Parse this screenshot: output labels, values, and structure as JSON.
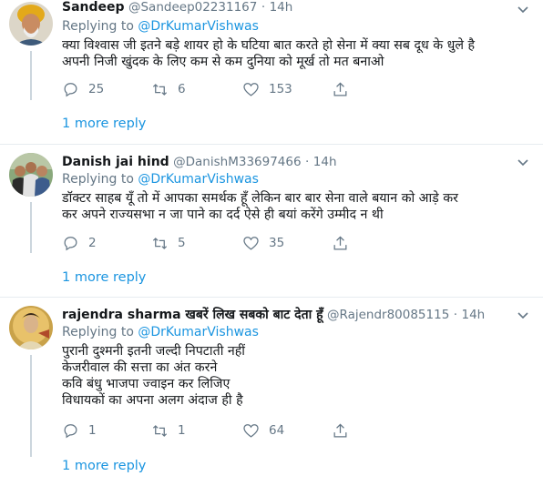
{
  "tweets": [
    {
      "name": "Sandeep",
      "handle": "@Sandeep02231167",
      "sep": "·",
      "time": "14h",
      "replying_prefix": "Replying to",
      "replying_to": "@DrKumarVishwas",
      "lines": [
        "क्या विश्वास जी इतने बड़े शायर हो के घटिया बात करते हो सेना में क्या सब दूध के धुले है",
        "अपनी निजी खुंदक के लिए कम से कम दुनिया को मूर्ख  तो मत बनाओ"
      ],
      "replies": "25",
      "retweets": "6",
      "likes": "153",
      "more": "1 more reply"
    },
    {
      "name": "Danish jai hind",
      "handle": "@DanishM33697466",
      "sep": "·",
      "time": "14h",
      "replying_prefix": "Replying to",
      "replying_to": "@DrKumarVishwas",
      "lines": [
        "डॉक्टर साहब यूँ तो में आपका समर्थक हूँ लेकिन बार बार सेना वाले बयान को आड़े कर",
        "कर अपने राज्यसभा न जा पाने का दर्द ऐसे ही बयां करेंगे उम्मीद न थी"
      ],
      "replies": "2",
      "retweets": "5",
      "likes": "35",
      "more": "1 more reply"
    },
    {
      "name": "rajendra sharma खबरें लिख सबको बाट देता हूँ",
      "handle": "@Rajendr80085115",
      "sep": "·",
      "time": "14h",
      "replying_prefix": "Replying to",
      "replying_to": "@DrKumarVishwas",
      "lines": [
        "पुरानी दुश्मनी इतनी जल्दी निपटाती नहीं",
        "केजरीवाल की सत्ता का अंत करने",
        "कवि बंधु  भाजपा ज्वाइन कर लिजिए",
        "विधायकों का अपना अलग अंदाज ही है"
      ],
      "replies": "1",
      "retweets": "1",
      "likes": "64",
      "more": "1 more reply"
    }
  ],
  "icons": {
    "reply": "reply-icon",
    "retweet": "retweet-icon",
    "like": "heart-icon",
    "share": "share-icon",
    "caret": "chevron-down-icon"
  },
  "colors": {
    "text": "#14171a",
    "secondary": "#657786",
    "link": "#1b95e0",
    "divider": "#e6ecf0",
    "thread_line": "#ccd6dd"
  }
}
